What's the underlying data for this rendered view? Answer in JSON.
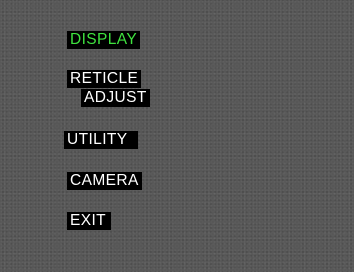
{
  "menu": {
    "items": [
      {
        "label": "DISPLAY",
        "selected": true
      },
      {
        "label": "RETICLE",
        "selected": false
      },
      {
        "label": "ADJUST",
        "selected": false
      },
      {
        "label": "UTILITY",
        "selected": false
      },
      {
        "label": "CAMERA",
        "selected": false
      },
      {
        "label": "EXIT",
        "selected": false
      }
    ]
  },
  "colors": {
    "background": "#555555",
    "highlight_bg": "#000000",
    "text": "#ffffff",
    "selected_text": "#3fe23f",
    "border": "#ffffff"
  }
}
